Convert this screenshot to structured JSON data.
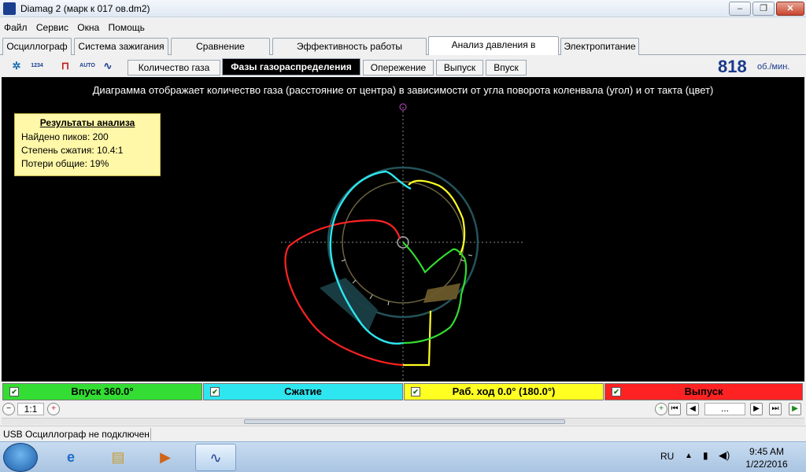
{
  "window": {
    "title": "Diamag 2 (марк к 017 ов.dm2)",
    "min": "–",
    "max": "❐",
    "close": "✕"
  },
  "menu": [
    "Файл",
    "Сервис",
    "Окна",
    "Помощь"
  ],
  "main_tabs": [
    "Осциллограф",
    "Система зажигания",
    "Сравнение цилиндров",
    "Эффективность работы цилиндров",
    "Анализ давления в цилиндре",
    "Электропитание"
  ],
  "active_main_tab": 4,
  "toolbar_icons": [
    "camera-icon",
    "counter-icon",
    "marker-icon",
    "auto-marker-icon",
    "waveform-icon"
  ],
  "toolbar_icon_text": {
    "counter": "1234",
    "auto": "AUTO"
  },
  "sub_tabs": [
    "Количество газа",
    "Фазы газораспределения",
    "Опережение",
    "Выпуск",
    "Впуск"
  ],
  "active_sub_tab": 1,
  "rpm": {
    "value": "818",
    "unit": "об./мин."
  },
  "plot": {
    "caption": "Диаграмма отображает количество газа (расстояние от центра) в зависимости от угла поворота коленвала (угол) и от такта (цвет)"
  },
  "results": {
    "title": "Результаты анализа",
    "lines": [
      "Найдено пиков: 200",
      "Степень сжатия: 10.4:1",
      "Потери общие: 19%"
    ]
  },
  "legend": [
    {
      "label": "Впуск 360.0°",
      "color": "#33dd33",
      "checked": true
    },
    {
      "label": "Сжатие",
      "color": "#2ee6f0",
      "checked": true
    },
    {
      "label": "Раб. ход 0.0° (180.0°)",
      "color": "#ffff22",
      "checked": true
    },
    {
      "label": "Выпуск",
      "color": "#ff2222",
      "checked": true
    }
  ],
  "zoom": {
    "label": "1:1"
  },
  "nav": {
    "dots": "..."
  },
  "status": {
    "text": "USB Осциллограф не подключен"
  },
  "taskbar": {
    "lang": "RU",
    "time": "9:45 AM",
    "date": "1/22/2016"
  }
}
